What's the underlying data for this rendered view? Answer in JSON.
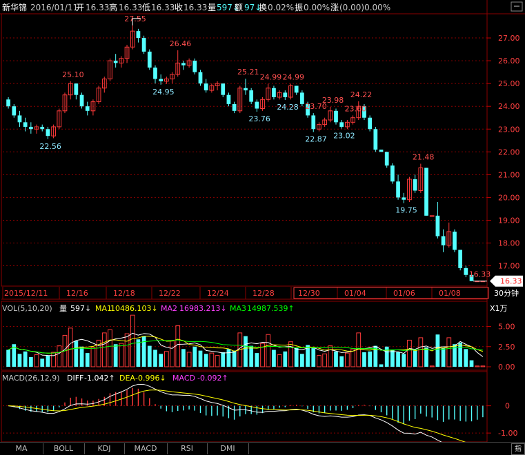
{
  "header": {
    "stock_name": "新华锦",
    "date": "2016/01/11",
    "open_label": "开",
    "open": "16.33",
    "high_label": "高",
    "high": "16.33",
    "low_label": "低",
    "low": "16.33",
    "close_label": "收",
    "close": "16.33",
    "vol_label": "量",
    "vol": "597↓",
    "amount_label": "额",
    "amount": "97↓",
    "turnover_label": "换",
    "turnover": "0.02%",
    "amplitude_label": "振",
    "amplitude": "0.00%",
    "change_label": "涨",
    "change": "(0.00)0.00%"
  },
  "price_panel": {
    "y_ticks": [
      "27.00",
      "26.00",
      "25.00",
      "24.00",
      "23.00",
      "22.00",
      "21.00",
      "20.00",
      "19.00",
      "18.00",
      "17.00"
    ],
    "current_price_tag": "16.33",
    "annotations": [
      "27.55",
      "26.46",
      "25.10",
      "24.95",
      "25.21",
      "24.99",
      "24.99",
      "24.22",
      "23.98",
      "23.60",
      "22.56",
      "23.70",
      "23.76",
      "24.28",
      "22.87",
      "23.02",
      "21.48",
      "19.75",
      "16.33"
    ]
  },
  "date_axis": {
    "labels": [
      "2015/12/11",
      "12/16",
      "12/18",
      "12/22",
      "12/24",
      "12/28",
      "12/30",
      "01/04",
      "01/06",
      "01/08"
    ],
    "period": "30分钟"
  },
  "volume_panel": {
    "title": "VOL(5,10,20)",
    "vol_label": "量",
    "vol_value": "597↓",
    "ma1_label": "MA1",
    "ma1_value": "10486.103↓",
    "ma2_label": "MA2",
    "ma2_value": "16983.213↓",
    "ma3_label": "MA3",
    "ma3_value": "14987.539↑",
    "unit": "X1万",
    "y_ticks": [
      "5.00",
      "2.50",
      "0.00"
    ]
  },
  "macd_panel": {
    "title": "MACD(26,12,9)",
    "diff_label": "DIFF",
    "diff_value": "-1.042↑",
    "dea_label": "DEA",
    "dea_value": "-0.996↓",
    "macd_label": "MACD",
    "macd_value": "-0.092↑",
    "y_ticks": [
      "0",
      "-1.00"
    ]
  },
  "tabs": [
    "MA",
    "BOLL",
    "KDJ",
    "MACD",
    "RSI",
    "DMI"
  ],
  "corner_button": "指",
  "colors": {
    "up": "#ff3a3a",
    "down": "#54ffff",
    "grid": "#8b0000",
    "ma1": "#ffffff",
    "ma2": "#ffff00",
    "ma3": "#ff40ff",
    "ma4": "#00ff00",
    "text_label_up": "#ff5050",
    "text_label_down": "#8ee8ff"
  },
  "chart_data": {
    "type": "candlestick",
    "interval": "30分钟",
    "y_range": [
      16.2,
      28.0
    ],
    "candles": [
      [
        24.3,
        24.4,
        23.9,
        24.0
      ],
      [
        24.0,
        24.1,
        23.5,
        23.6
      ],
      [
        23.6,
        23.8,
        23.1,
        23.3
      ],
      [
        23.3,
        23.5,
        22.9,
        23.1
      ],
      [
        23.1,
        23.3,
        22.8,
        23.0
      ],
      [
        23.0,
        23.2,
        22.8,
        23.1
      ],
      [
        23.1,
        23.2,
        22.9,
        23.0
      ],
      [
        23.0,
        23.1,
        22.56,
        22.7
      ],
      [
        22.7,
        23.2,
        22.6,
        23.1
      ],
      [
        23.1,
        23.9,
        23.0,
        23.8
      ],
      [
        23.8,
        24.6,
        23.7,
        24.5
      ],
      [
        24.5,
        25.1,
        24.3,
        25.0
      ],
      [
        25.0,
        25.0,
        24.3,
        24.5
      ],
      [
        24.5,
        24.6,
        23.9,
        24.0
      ],
      [
        24.0,
        24.2,
        23.6,
        23.8
      ],
      [
        23.8,
        24.3,
        23.6,
        24.2
      ],
      [
        24.2,
        24.9,
        24.1,
        24.8
      ],
      [
        24.8,
        25.3,
        24.6,
        25.2
      ],
      [
        25.2,
        26.1,
        25.1,
        26.0
      ],
      [
        26.0,
        26.3,
        25.7,
        25.9
      ],
      [
        25.9,
        26.2,
        25.7,
        26.1
      ],
      [
        26.1,
        26.7,
        25.9,
        26.6
      ],
      [
        26.6,
        27.55,
        26.5,
        27.3
      ],
      [
        27.3,
        27.4,
        26.8,
        27.0
      ],
      [
        27.0,
        27.1,
        26.3,
        26.4
      ],
      [
        26.4,
        26.5,
        25.6,
        25.7
      ],
      [
        25.7,
        25.8,
        25.0,
        25.2
      ],
      [
        25.2,
        25.4,
        24.95,
        25.1
      ],
      [
        25.1,
        25.3,
        24.98,
        25.2
      ],
      [
        25.2,
        25.5,
        25.0,
        25.4
      ],
      [
        25.4,
        26.46,
        25.3,
        25.9
      ],
      [
        25.9,
        26.0,
        25.6,
        25.8
      ],
      [
        25.8,
        26.1,
        25.7,
        26.0
      ],
      [
        26.0,
        26.1,
        25.4,
        25.5
      ],
      [
        25.5,
        25.6,
        24.9,
        25.0
      ],
      [
        25.0,
        25.2,
        24.6,
        24.7
      ],
      [
        24.7,
        25.0,
        24.6,
        24.9
      ],
      [
        24.9,
        25.1,
        24.7,
        25.0
      ],
      [
        25.0,
        25.0,
        24.4,
        24.5
      ],
      [
        24.5,
        24.6,
        24.0,
        24.1
      ],
      [
        24.1,
        24.2,
        23.7,
        23.8
      ],
      [
        23.8,
        24.9,
        23.7,
        24.8
      ],
      [
        24.8,
        25.21,
        24.5,
        24.7
      ],
      [
        24.7,
        24.8,
        24.1,
        24.2
      ],
      [
        24.2,
        24.3,
        23.76,
        23.9
      ],
      [
        23.9,
        24.4,
        23.8,
        24.3
      ],
      [
        24.3,
        24.99,
        24.2,
        24.8
      ],
      [
        24.8,
        24.9,
        24.3,
        24.4
      ],
      [
        24.4,
        24.7,
        24.3,
        24.6
      ],
      [
        24.6,
        24.7,
        24.28,
        24.4
      ],
      [
        24.4,
        24.99,
        24.3,
        24.9
      ],
      [
        24.9,
        24.9,
        24.5,
        24.6
      ],
      [
        24.6,
        24.7,
        24.0,
        24.1
      ],
      [
        24.1,
        24.2,
        23.5,
        23.6
      ],
      [
        23.6,
        23.7,
        22.87,
        23.0
      ],
      [
        23.0,
        23.3,
        22.9,
        23.2
      ],
      [
        23.2,
        23.5,
        23.1,
        23.4
      ],
      [
        23.4,
        23.98,
        23.3,
        23.8
      ],
      [
        23.8,
        23.9,
        23.2,
        23.3
      ],
      [
        23.3,
        23.4,
        23.02,
        23.1
      ],
      [
        23.1,
        23.4,
        23.0,
        23.3
      ],
      [
        23.3,
        23.6,
        23.2,
        23.5
      ],
      [
        23.5,
        24.22,
        23.4,
        24.0
      ],
      [
        24.0,
        24.1,
        23.4,
        23.5
      ],
      [
        23.5,
        23.6,
        22.9,
        23.0
      ],
      [
        23.0,
        23.1,
        22.0,
        22.1
      ],
      [
        22.1,
        22.1,
        22.0,
        22.0
      ],
      [
        22.0,
        22.0,
        21.3,
        21.4
      ],
      [
        21.4,
        21.5,
        20.6,
        20.7
      ],
      [
        20.7,
        21.0,
        19.9,
        20.0
      ],
      [
        20.0,
        20.2,
        19.75,
        19.9
      ],
      [
        19.9,
        20.9,
        19.8,
        20.8
      ],
      [
        20.8,
        21.0,
        20.2,
        20.3
      ],
      [
        20.3,
        21.48,
        20.2,
        21.3
      ],
      [
        21.3,
        21.3,
        19.2,
        19.2
      ],
      [
        19.2,
        19.2,
        19.2,
        19.2
      ],
      [
        19.2,
        19.8,
        18.2,
        18.3
      ],
      [
        18.3,
        18.6,
        17.6,
        17.9
      ],
      [
        17.9,
        18.9,
        17.8,
        18.5
      ],
      [
        18.5,
        18.6,
        17.6,
        17.7
      ],
      [
        17.7,
        17.7,
        16.8,
        16.9
      ],
      [
        16.9,
        17.0,
        16.5,
        16.6
      ],
      [
        16.6,
        16.6,
        16.33,
        16.33
      ],
      [
        16.33,
        16.33,
        16.33,
        16.33
      ],
      [
        16.33,
        16.33,
        16.33,
        16.33
      ]
    ],
    "volume": [
      2.1,
      2.8,
      1.6,
      1.9,
      1.2,
      1.5,
      1.0,
      1.4,
      1.8,
      2.6,
      3.9,
      4.8,
      3.2,
      2.5,
      1.7,
      2.4,
      3.3,
      4.2,
      4.6,
      2.8,
      2.9,
      4.1,
      6.4,
      3.4,
      3.8,
      2.6,
      2.1,
      1.6,
      1.9,
      3.2,
      5.1,
      2.2,
      1.8,
      2.5,
      2.0,
      1.6,
      1.7,
      1.4,
      1.8,
      2.2,
      2.0,
      4.2,
      3.8,
      2.6,
      1.7,
      2.9,
      4.0,
      2.1,
      1.5,
      1.9,
      3.1,
      2.4,
      1.6,
      2.7,
      2.3,
      1.4,
      1.6,
      2.6,
      1.9,
      1.3,
      1.7,
      2.2,
      4.2,
      1.8,
      1.9,
      2.6,
      0.3,
      2.5,
      2.1,
      1.8,
      1.6,
      3.3,
      2.0,
      3.6,
      2.4,
      0.1,
      4.0,
      2.3,
      3.6,
      2.8,
      3.0,
      2.2,
      0.8,
      0.1,
      0.1
    ],
    "volume_range": [
      0,
      6.5
    ],
    "macd_range": [
      -1.3,
      0.8
    ]
  }
}
